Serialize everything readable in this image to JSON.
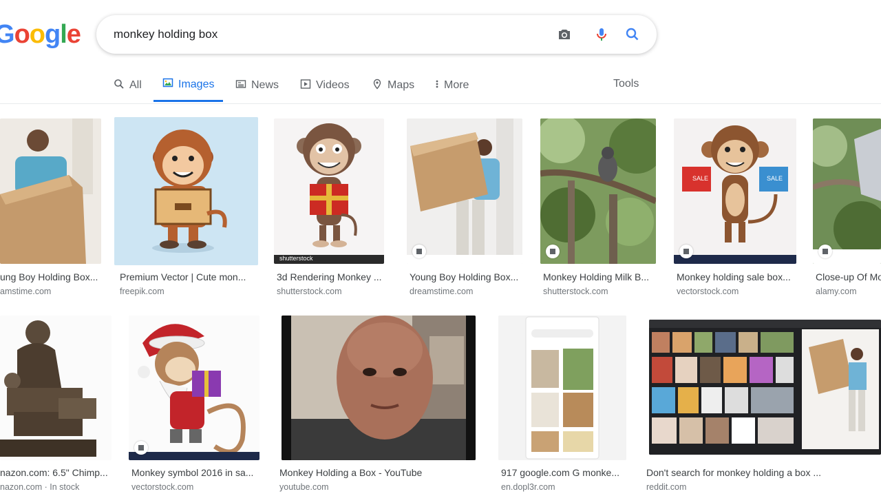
{
  "logo": "Google",
  "search": {
    "query": "monkey holding box"
  },
  "tabs": [
    {
      "label": "All",
      "icon": "search-icon"
    },
    {
      "label": "Images",
      "icon": "image-icon",
      "active": true
    },
    {
      "label": "News",
      "icon": "news-icon"
    },
    {
      "label": "Videos",
      "icon": "video-icon"
    },
    {
      "label": "Maps",
      "icon": "map-pin-icon"
    },
    {
      "label": "More",
      "icon": "more-vert-icon"
    }
  ],
  "tools_label": "Tools",
  "results": [
    {
      "caption": "ung Boy Holding Box...",
      "source": "amstime.com"
    },
    {
      "caption": "Premium Vector | Cute mon...",
      "source": "freepik.com"
    },
    {
      "caption": "3d Rendering Monkey ...",
      "source": "shutterstock.com"
    },
    {
      "caption": "Young Boy Holding Box...",
      "source": "dreamstime.com"
    },
    {
      "caption": "Monkey Holding Milk B...",
      "source": "shutterstock.com"
    },
    {
      "caption": "Monkey holding sale box...",
      "source": "vectorstock.com"
    },
    {
      "caption": "Close-up Of Mo",
      "source": "alamy.com"
    },
    {
      "caption": "nazon.com: 6.5\" Chimp...",
      "source": "nazon.com · In stock"
    },
    {
      "caption": "Monkey symbol 2016 in sa...",
      "source": "vectorstock.com"
    },
    {
      "caption": "Monkey Holding a Box - YouTube",
      "source": "youtube.com"
    },
    {
      "caption": "917 google.com G monke...",
      "source": "en.dopl3r.com"
    },
    {
      "caption": "Don't search for monkey holding a box ...",
      "source": "reddit.com"
    }
  ],
  "overlay_text": {
    "shutterstock_mark": "shutterstock",
    "sale_left": "SALE",
    "sale_right": "SALE"
  },
  "colors": {
    "accent": "#1a73e8",
    "google_blue": "#4285f4",
    "google_red": "#ea4335",
    "google_yellow": "#fbbc05",
    "google_green": "#34a853"
  }
}
